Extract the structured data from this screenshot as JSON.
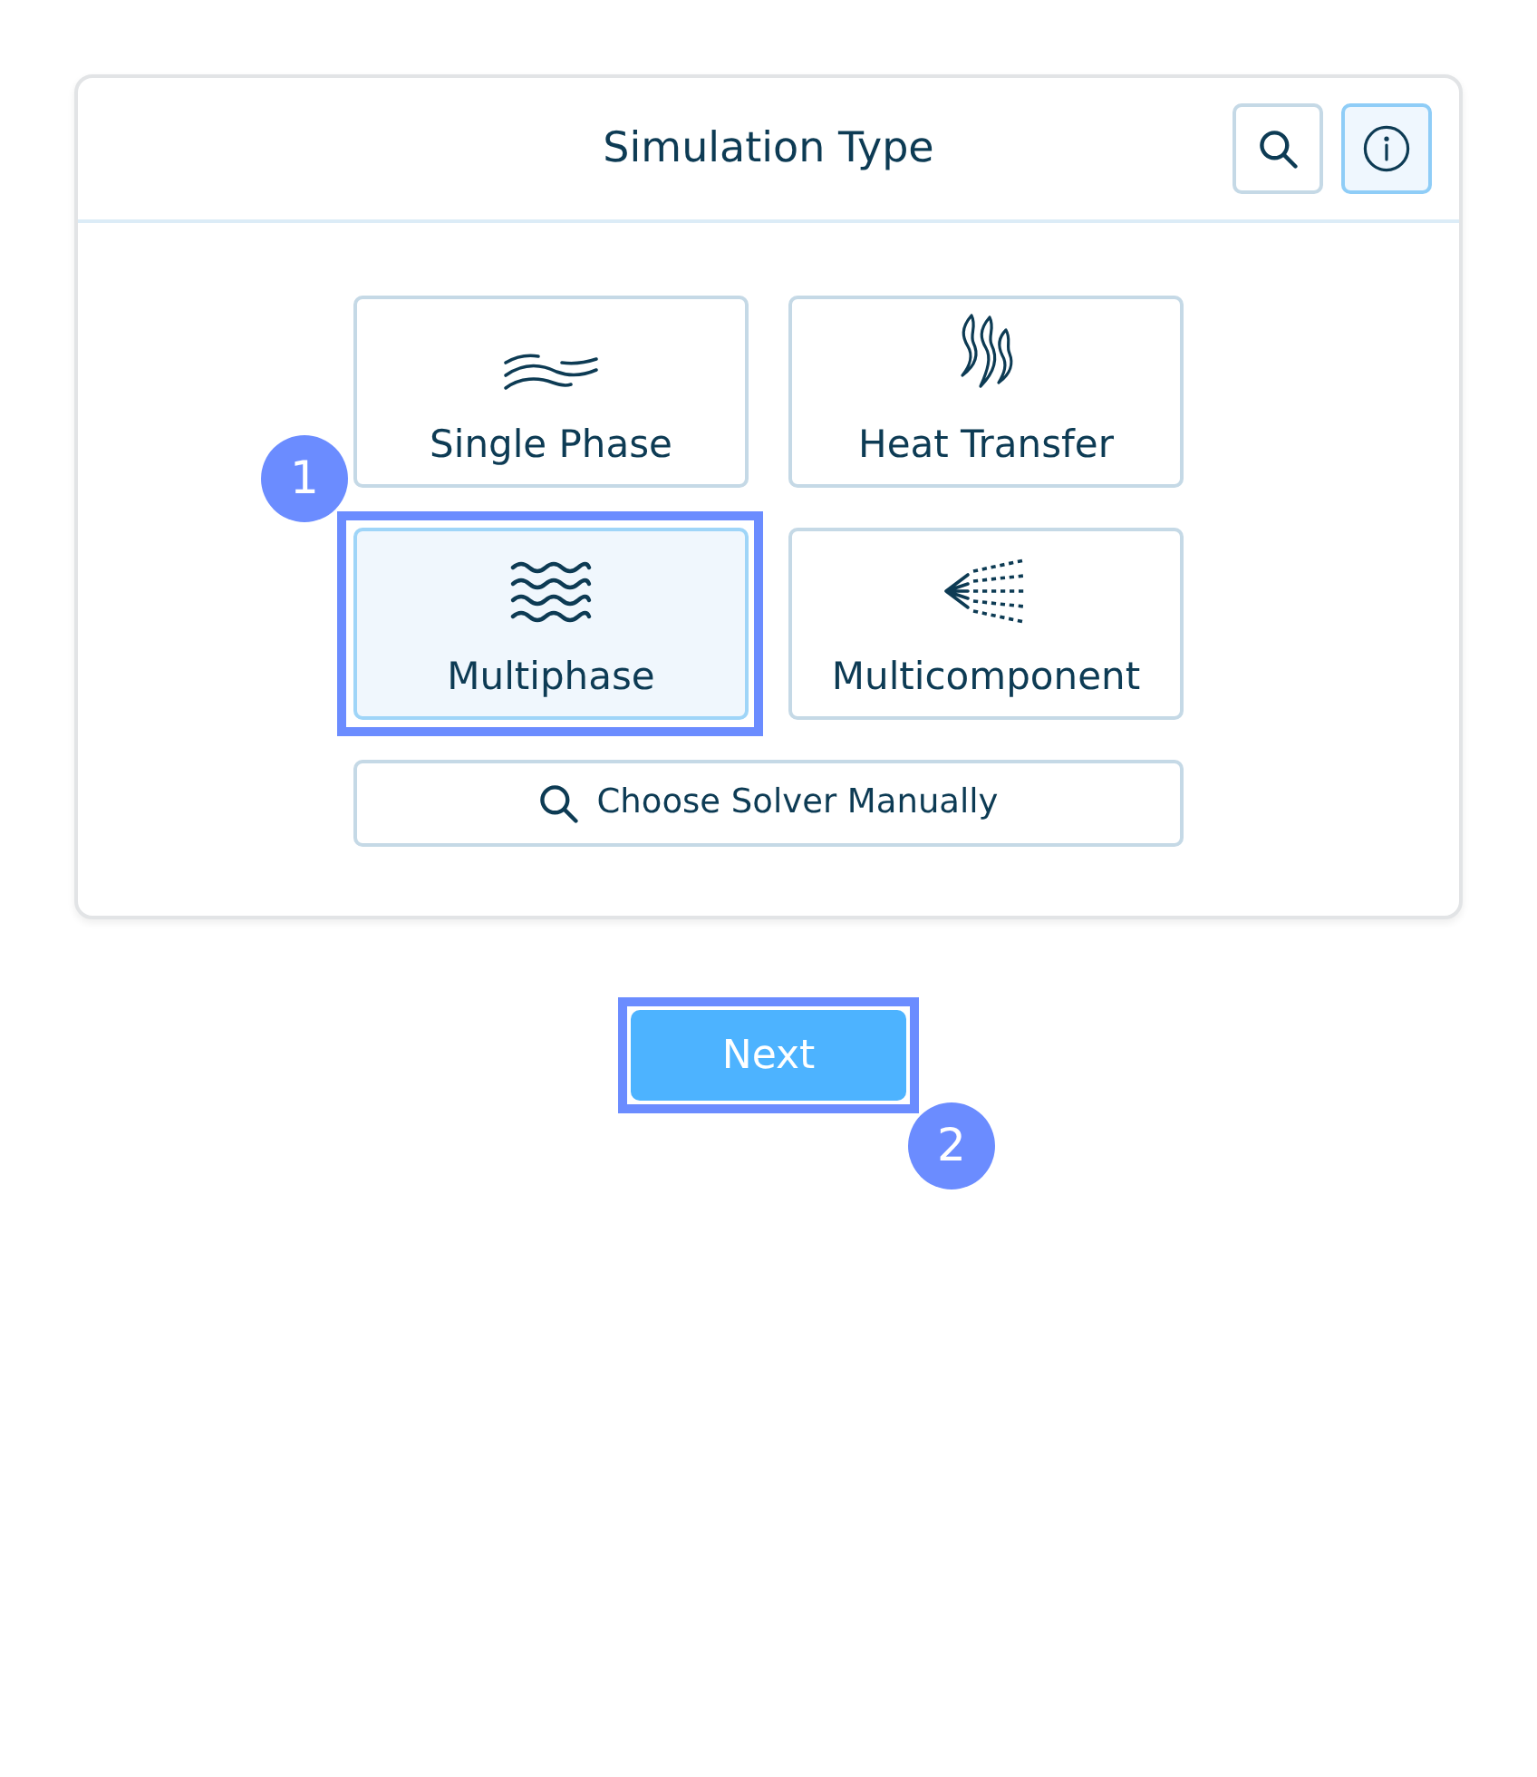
{
  "panel": {
    "title": "Simulation Type",
    "header_buttons": [
      {
        "kind": "search",
        "selected": false
      },
      {
        "kind": "info",
        "selected": true
      }
    ]
  },
  "options": [
    {
      "kind": "single_phase",
      "label": "Single Phase",
      "selected": false
    },
    {
      "kind": "heat_transfer",
      "label": "Heat Transfer",
      "selected": false
    },
    {
      "kind": "multiphase",
      "label": "Multiphase",
      "selected": true,
      "callout": "1"
    },
    {
      "kind": "multicomponent",
      "label": "Multicomponent",
      "selected": false
    }
  ],
  "manual_button": {
    "label": "Choose Solver Manually"
  },
  "next_button": {
    "label": "Next",
    "callout": "2"
  }
}
